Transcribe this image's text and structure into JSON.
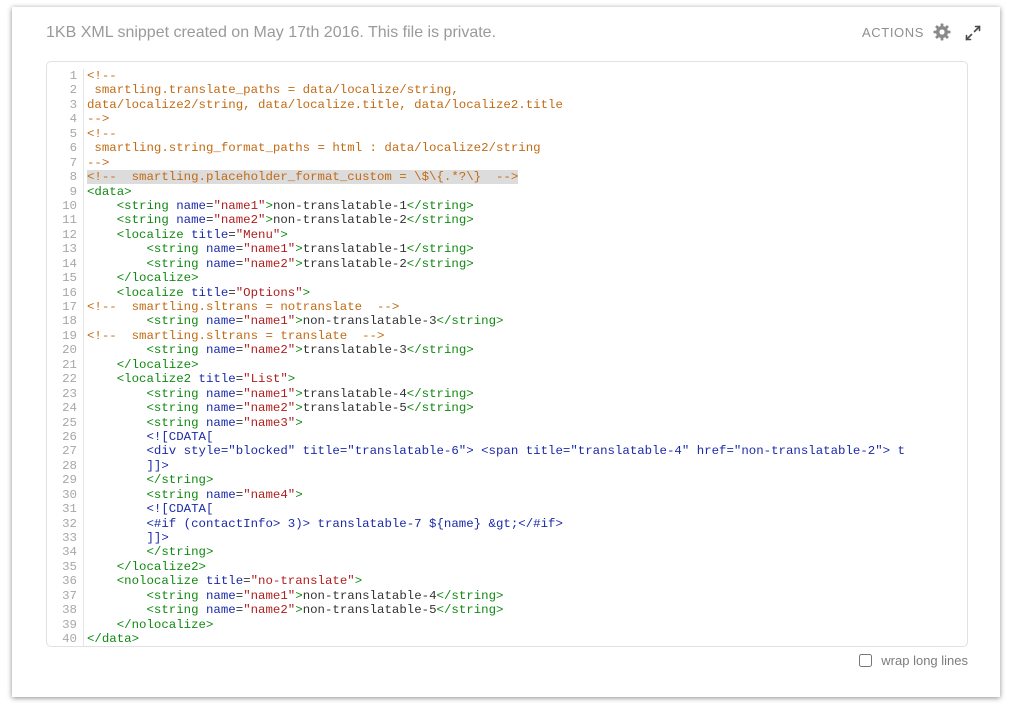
{
  "header": {
    "title": "1KB XML snippet created on May 17th 2016. This file is private.",
    "actions_label": "ACTIONS",
    "settings_icon": "gear-icon",
    "expand_icon": "expand-arrows-icon"
  },
  "colors": {
    "comment": "#c26b14",
    "tag": "#118a11",
    "attribute": "#1b2aa8",
    "string": "#b01e1e",
    "highlight_line": "#dcdcdc"
  },
  "code": {
    "highlighted_line": 8,
    "lines": [
      [
        [
          "c",
          "<!--"
        ]
      ],
      [
        [
          "c",
          " smartling.translate_paths = data/localize/string,"
        ]
      ],
      [
        [
          "c",
          "data/localize2/string, data/localize.title, data/localize2.title"
        ]
      ],
      [
        [
          "c",
          "-->"
        ]
      ],
      [
        [
          "c",
          "<!--"
        ]
      ],
      [
        [
          "c",
          " smartling.string_format_paths = html : data/localize2/string"
        ]
      ],
      [
        [
          "c",
          "-->"
        ]
      ],
      [
        [
          "c",
          "<!--  smartling.placeholder_format_custom = \\$\\{.*?\\}  -->"
        ]
      ],
      [
        [
          "g",
          "<data>"
        ]
      ],
      [
        [
          "t",
          "    "
        ],
        [
          "g",
          "<string "
        ],
        [
          "a",
          "name"
        ],
        [
          "t",
          "="
        ],
        [
          "s",
          "\"name1\""
        ],
        [
          "g",
          ">"
        ],
        [
          "t",
          "non-translatable-1"
        ],
        [
          "g",
          "</string>"
        ]
      ],
      [
        [
          "t",
          "    "
        ],
        [
          "g",
          "<string "
        ],
        [
          "a",
          "name"
        ],
        [
          "t",
          "="
        ],
        [
          "s",
          "\"name2\""
        ],
        [
          "g",
          ">"
        ],
        [
          "t",
          "non-translatable-2"
        ],
        [
          "g",
          "</string>"
        ]
      ],
      [
        [
          "t",
          "    "
        ],
        [
          "g",
          "<localize "
        ],
        [
          "a",
          "title"
        ],
        [
          "t",
          "="
        ],
        [
          "s",
          "\"Menu\""
        ],
        [
          "g",
          ">"
        ]
      ],
      [
        [
          "t",
          "        "
        ],
        [
          "g",
          "<string "
        ],
        [
          "a",
          "name"
        ],
        [
          "t",
          "="
        ],
        [
          "s",
          "\"name1\""
        ],
        [
          "g",
          ">"
        ],
        [
          "t",
          "translatable-1"
        ],
        [
          "g",
          "</string>"
        ]
      ],
      [
        [
          "t",
          "        "
        ],
        [
          "g",
          "<string "
        ],
        [
          "a",
          "name"
        ],
        [
          "t",
          "="
        ],
        [
          "s",
          "\"name2\""
        ],
        [
          "g",
          ">"
        ],
        [
          "t",
          "translatable-2"
        ],
        [
          "g",
          "</string>"
        ]
      ],
      [
        [
          "t",
          "    "
        ],
        [
          "g",
          "</localize>"
        ]
      ],
      [
        [
          "t",
          "    "
        ],
        [
          "g",
          "<localize "
        ],
        [
          "a",
          "title"
        ],
        [
          "t",
          "="
        ],
        [
          "s",
          "\"Options\""
        ],
        [
          "g",
          ">"
        ]
      ],
      [
        [
          "c",
          "<!--  smartling.sltrans = notranslate  -->"
        ]
      ],
      [
        [
          "t",
          "        "
        ],
        [
          "g",
          "<string "
        ],
        [
          "a",
          "name"
        ],
        [
          "t",
          "="
        ],
        [
          "s",
          "\"name1\""
        ],
        [
          "g",
          ">"
        ],
        [
          "t",
          "non-translatable-3"
        ],
        [
          "g",
          "</string>"
        ]
      ],
      [
        [
          "c",
          "<!--  smartling.sltrans = translate  -->"
        ]
      ],
      [
        [
          "t",
          "        "
        ],
        [
          "g",
          "<string "
        ],
        [
          "a",
          "name"
        ],
        [
          "t",
          "="
        ],
        [
          "s",
          "\"name2\""
        ],
        [
          "g",
          ">"
        ],
        [
          "t",
          "translatable-3"
        ],
        [
          "g",
          "</string>"
        ]
      ],
      [
        [
          "t",
          "    "
        ],
        [
          "g",
          "</localize>"
        ]
      ],
      [
        [
          "t",
          "    "
        ],
        [
          "g",
          "<localize2 "
        ],
        [
          "a",
          "title"
        ],
        [
          "t",
          "="
        ],
        [
          "s",
          "\"List\""
        ],
        [
          "g",
          ">"
        ]
      ],
      [
        [
          "t",
          "        "
        ],
        [
          "g",
          "<string "
        ],
        [
          "a",
          "name"
        ],
        [
          "t",
          "="
        ],
        [
          "s",
          "\"name1\""
        ],
        [
          "g",
          ">"
        ],
        [
          "t",
          "translatable-4"
        ],
        [
          "g",
          "</string>"
        ]
      ],
      [
        [
          "t",
          "        "
        ],
        [
          "g",
          "<string "
        ],
        [
          "a",
          "name"
        ],
        [
          "t",
          "="
        ],
        [
          "s",
          "\"name2\""
        ],
        [
          "g",
          ">"
        ],
        [
          "t",
          "translatable-5"
        ],
        [
          "g",
          "</string>"
        ]
      ],
      [
        [
          "t",
          "        "
        ],
        [
          "g",
          "<string "
        ],
        [
          "a",
          "name"
        ],
        [
          "t",
          "="
        ],
        [
          "s",
          "\"name3\""
        ],
        [
          "g",
          ">"
        ]
      ],
      [
        [
          "t",
          "        "
        ],
        [
          "d",
          "<![CDATA["
        ]
      ],
      [
        [
          "t",
          "        "
        ],
        [
          "d",
          "<div style=\"blocked\" title=\"translatable-6\"> <span title=\"translatable-4\" href=\"non-translatable-2\"> t"
        ]
      ],
      [
        [
          "t",
          "        "
        ],
        [
          "d",
          "]]>"
        ]
      ],
      [
        [
          "t",
          "        "
        ],
        [
          "g",
          "</string>"
        ]
      ],
      [
        [
          "t",
          "        "
        ],
        [
          "g",
          "<string "
        ],
        [
          "a",
          "name"
        ],
        [
          "t",
          "="
        ],
        [
          "s",
          "\"name4\""
        ],
        [
          "g",
          ">"
        ]
      ],
      [
        [
          "t",
          "        "
        ],
        [
          "d",
          "<![CDATA["
        ]
      ],
      [
        [
          "t",
          "        "
        ],
        [
          "d",
          "<#if (contactInfo> 3)> translatable-7 ${name} &gt;</#if>"
        ]
      ],
      [
        [
          "t",
          "        "
        ],
        [
          "d",
          "]]>"
        ]
      ],
      [
        [
          "t",
          "        "
        ],
        [
          "g",
          "</string>"
        ]
      ],
      [
        [
          "t",
          "    "
        ],
        [
          "g",
          "</localize2>"
        ]
      ],
      [
        [
          "t",
          "    "
        ],
        [
          "g",
          "<nolocalize "
        ],
        [
          "a",
          "title"
        ],
        [
          "t",
          "="
        ],
        [
          "s",
          "\"no-translate\""
        ],
        [
          "g",
          ">"
        ]
      ],
      [
        [
          "t",
          "        "
        ],
        [
          "g",
          "<string "
        ],
        [
          "a",
          "name"
        ],
        [
          "t",
          "="
        ],
        [
          "s",
          "\"name1\""
        ],
        [
          "g",
          ">"
        ],
        [
          "t",
          "non-translatable-4"
        ],
        [
          "g",
          "</string>"
        ]
      ],
      [
        [
          "t",
          "        "
        ],
        [
          "g",
          "<string "
        ],
        [
          "a",
          "name"
        ],
        [
          "t",
          "="
        ],
        [
          "s",
          "\"name2\""
        ],
        [
          "g",
          ">"
        ],
        [
          "t",
          "non-translatable-5"
        ],
        [
          "g",
          "</string>"
        ]
      ],
      [
        [
          "t",
          "    "
        ],
        [
          "g",
          "</nolocalize>"
        ]
      ],
      [
        [
          "g",
          "</data>"
        ]
      ]
    ]
  },
  "footer": {
    "wrap_label": "wrap long lines",
    "wrap_checked": false
  }
}
